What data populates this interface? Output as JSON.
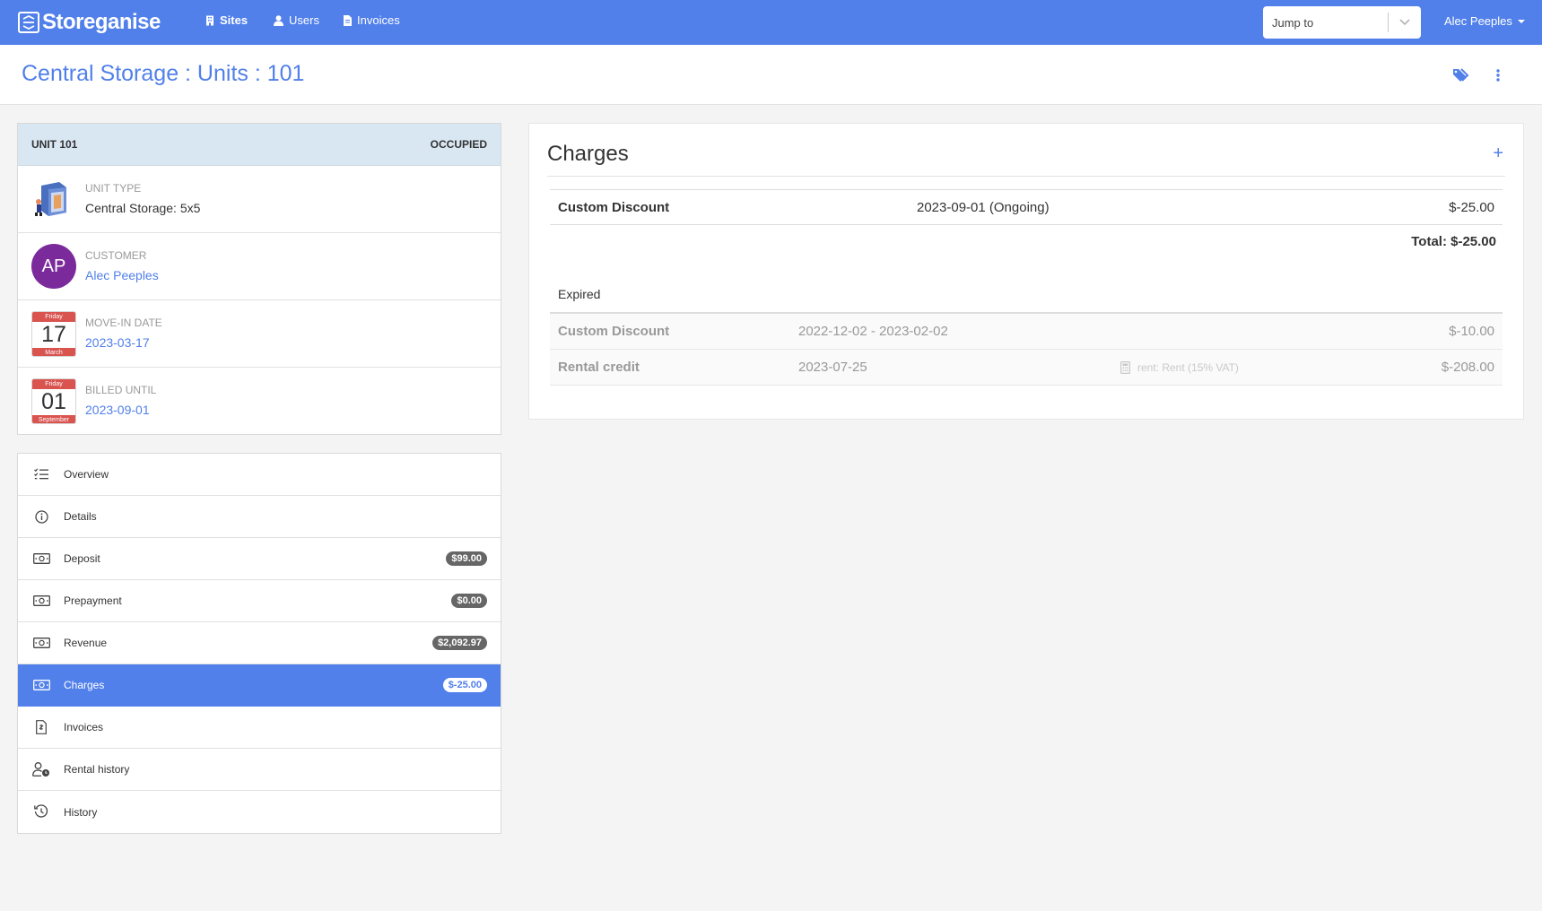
{
  "brand": {
    "name": "Storeganise"
  },
  "nav": {
    "sites": "Sites",
    "users": "Users",
    "invoices": "Invoices"
  },
  "jump_to": {
    "placeholder": "Jump to"
  },
  "user_menu": {
    "name": "Alec Peeples"
  },
  "page": {
    "title": "Central Storage : Units : 101"
  },
  "unit": {
    "header": "UNIT 101",
    "status": "OCCUPIED",
    "unit_type_label": "UNIT TYPE",
    "unit_type_value": "Central Storage: 5x5",
    "customer_label": "CUSTOMER",
    "customer_initials": "AP",
    "customer_name": "Alec Peeples",
    "move_in_label": "MOVE-IN DATE",
    "move_in_value": "2023-03-17",
    "move_in_cal": {
      "day": "Friday",
      "num": "17",
      "month": "March"
    },
    "billed_label": "BILLED UNTIL",
    "billed_value": "2023-09-01",
    "billed_cal": {
      "day": "Friday",
      "num": "01",
      "month": "September"
    }
  },
  "menu": [
    {
      "label": "Overview",
      "icon": "list-check-icon"
    },
    {
      "label": "Details",
      "icon": "info-circle-icon"
    },
    {
      "label": "Deposit",
      "icon": "money-bill-icon",
      "badge": "$99.00"
    },
    {
      "label": "Prepayment",
      "icon": "money-bill-icon",
      "badge": "$0.00"
    },
    {
      "label": "Revenue",
      "icon": "money-bill-icon",
      "badge": "$2,092.97"
    },
    {
      "label": "Charges",
      "icon": "money-bill-icon",
      "badge": "$-25.00",
      "active": true
    },
    {
      "label": "Invoices",
      "icon": "file-invoice-icon"
    },
    {
      "label": "Rental history",
      "icon": "user-clock-icon"
    },
    {
      "label": "History",
      "icon": "history-icon"
    }
  ],
  "charges": {
    "title": "Charges",
    "add": "+",
    "current": [
      {
        "name": "Custom Discount",
        "date": "2023-09-01 (Ongoing)",
        "amount": "$-25.00"
      }
    ],
    "total": "Total: $-25.00",
    "expired_title": "Expired",
    "expired": [
      {
        "name": "Custom Discount",
        "date": "2022-12-02 - 2023-02-02",
        "amount": "$-10.00",
        "note": ""
      },
      {
        "name": "Rental credit",
        "date": "2023-07-25",
        "amount": "$-208.00",
        "note": "rent: Rent (15% VAT)"
      }
    ]
  },
  "colors": {
    "primary": "#5180ea",
    "avatar": "#7b2a9b",
    "calendar": "#d9534f",
    "unit_header": "#d9e7f3"
  }
}
